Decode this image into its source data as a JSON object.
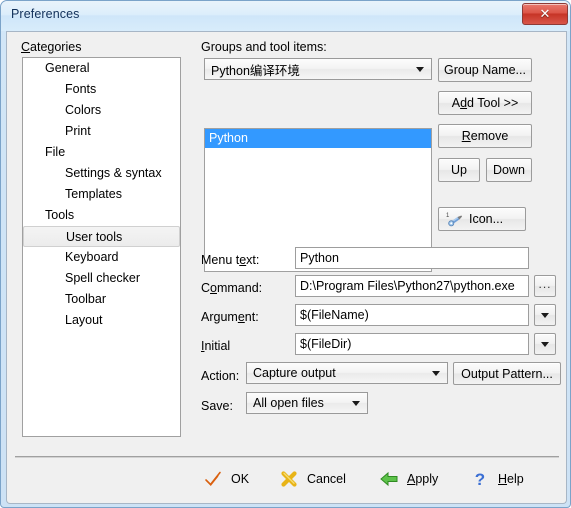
{
  "window": {
    "title": "Preferences",
    "close_label": "✕"
  },
  "categories": {
    "label": "Categories",
    "label_mnemonic": "C",
    "items": [
      {
        "label": "General",
        "level": 1,
        "selected": false
      },
      {
        "label": "Fonts",
        "level": 2,
        "selected": false
      },
      {
        "label": "Colors",
        "level": 2,
        "selected": false
      },
      {
        "label": "Print",
        "level": 2,
        "selected": false
      },
      {
        "label": "File",
        "level": 1,
        "selected": false
      },
      {
        "label": "Settings & syntax",
        "level": 2,
        "selected": false
      },
      {
        "label": "Templates",
        "level": 2,
        "selected": false
      },
      {
        "label": "Tools",
        "level": 1,
        "selected": false
      },
      {
        "label": "User tools",
        "level": 2,
        "selected": true
      },
      {
        "label": "Keyboard",
        "level": 2,
        "selected": false
      },
      {
        "label": "Spell checker",
        "level": 2,
        "selected": false
      },
      {
        "label": "Toolbar",
        "level": 2,
        "selected": false
      },
      {
        "label": "Layout",
        "level": 2,
        "selected": false
      }
    ]
  },
  "groups": {
    "label": "Groups and tool items:",
    "combo_value": "Python编译环境",
    "tools": [
      {
        "label": "Python",
        "selected": true
      }
    ],
    "buttons": {
      "group_name": "Group Name...",
      "add_tool": "Add Tool >>",
      "remove": "Remove",
      "up": "Up",
      "down": "Down",
      "icon": "Icon..."
    }
  },
  "form": {
    "menu_text": {
      "label": "Menu text:",
      "value": "Python"
    },
    "command": {
      "label": "Command:",
      "value": "D:\\Program Files\\Python27\\python.exe",
      "browse_label": "..."
    },
    "argument": {
      "label": "Argument:",
      "value": "$(FileName)"
    },
    "initial": {
      "label": "Initial",
      "value": "$(FileDir)"
    },
    "action": {
      "label": "Action:",
      "value": "Capture output",
      "pattern_button": "Output Pattern..."
    },
    "save": {
      "label": "Save:",
      "value": "All open files"
    }
  },
  "footer": {
    "ok": "OK",
    "cancel": "Cancel",
    "apply": "Apply",
    "help": "Help"
  },
  "colors": {
    "selection_blue": "#3399ff",
    "titlebar_blue": "#d3e7f7",
    "close_red": "#c63426",
    "ok_check": "#e06010",
    "cancel_x": "#e8b417",
    "apply_arrow": "#33aa33",
    "help_q": "#3b6fd4"
  }
}
